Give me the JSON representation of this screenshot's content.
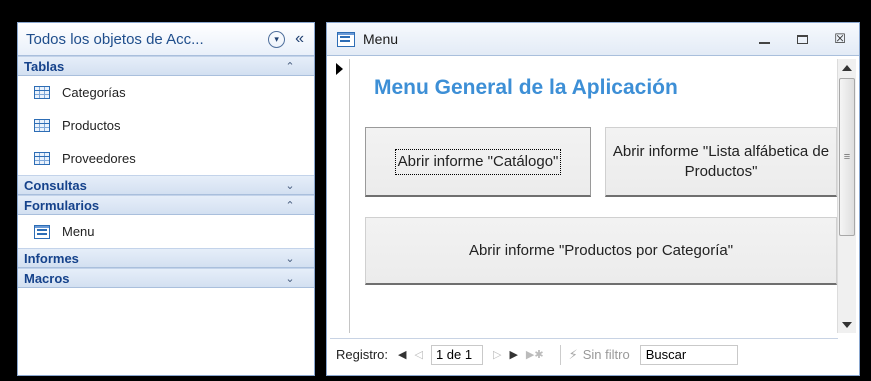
{
  "nav_pane": {
    "title": "Todos los objetos de Acc...",
    "menu_glyph": "▾",
    "collapse_glyph": "«",
    "groups": [
      {
        "label": "Tablas",
        "chevron": "⌃",
        "items": [
          "Categorías",
          "Productos",
          "Proveedores"
        ]
      },
      {
        "label": "Consultas",
        "chevron": "⌄",
        "items": []
      },
      {
        "label": "Formularios",
        "chevron": "⌃",
        "items": [
          "Menu"
        ]
      },
      {
        "label": "Informes",
        "chevron": "⌄",
        "items": []
      },
      {
        "label": "Macros",
        "chevron": "⌄",
        "items": []
      }
    ]
  },
  "window": {
    "title": "Menu",
    "minimize": "",
    "maximize": "",
    "close": "☒"
  },
  "form": {
    "heading": "Menu General de la Aplicación",
    "buttons": {
      "catalogo": "Abrir informe \"Catálogo\"",
      "lista": "Abrir informe \"Lista alfábetica de Productos\"",
      "categoria": "Abrir informe \"Productos por Categoría\""
    }
  },
  "scrollbar": {
    "grip": "≡"
  },
  "record_nav": {
    "label": "Registro:",
    "first": "◀",
    "prev": "◁",
    "position": "1 de 1",
    "next": "▷",
    "last": "▶",
    "new": "▶✱",
    "filter_icon": "⚡",
    "filter_label": "Sin filtro",
    "search_placeholder": "Buscar"
  },
  "colors": {
    "heading": "#3d8fd6",
    "group_header": "#15428b",
    "nav_border": "#8aa7cf"
  }
}
